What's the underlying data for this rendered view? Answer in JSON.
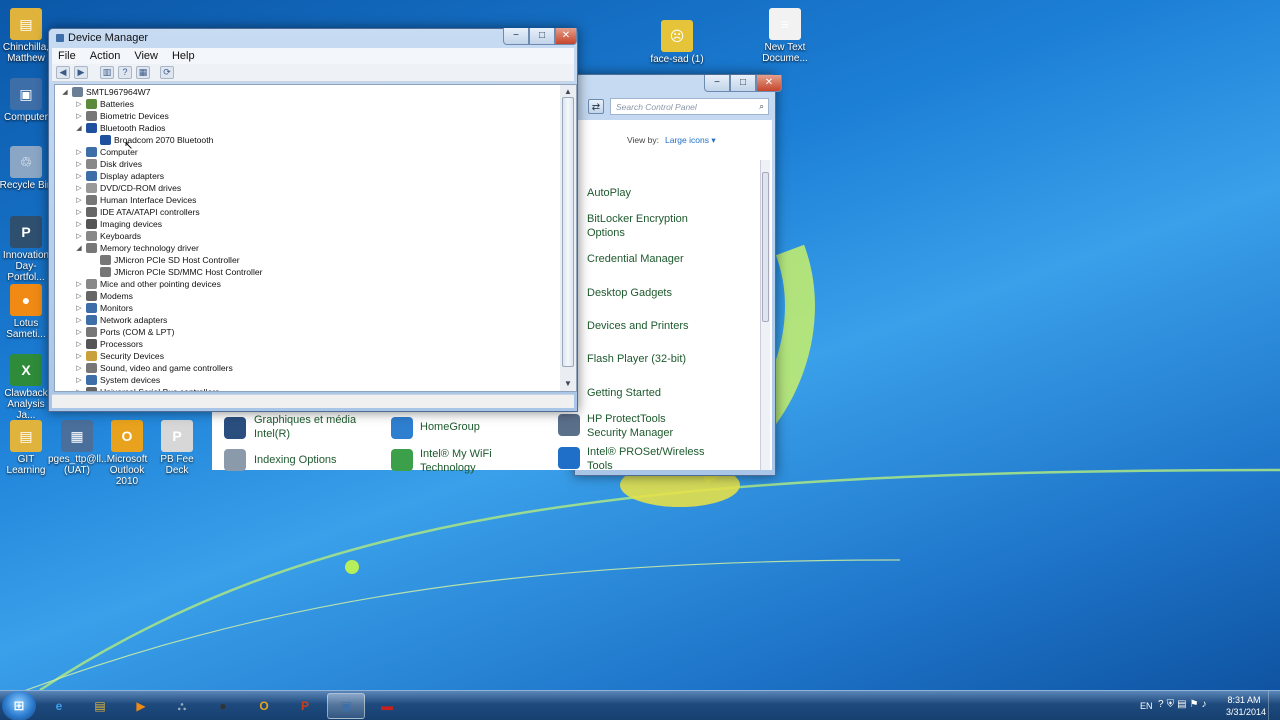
{
  "desktop": {
    "icons": [
      {
        "label": "Chinchilla, Matthew",
        "color": "#e0b43c",
        "glyph": "▤"
      },
      {
        "label": "Computer",
        "color": "#3d6ea8",
        "glyph": "▣"
      },
      {
        "label": "Recycle Bin",
        "color": "#8aa6c4",
        "glyph": "♲"
      },
      {
        "label": "Innovation Day-Portfol...",
        "color": "#2f4f6f",
        "glyph": "P"
      },
      {
        "label": "Lotus Sameti...",
        "color": "#f08a14",
        "glyph": "●"
      },
      {
        "label": "Clawback Analysis Ja...",
        "color": "#2e8b3a",
        "glyph": "X"
      },
      {
        "label": "GIT Learning",
        "color": "#e0b43c",
        "glyph": "▤"
      },
      {
        "label": "pges_ttp@ll... (UAT)",
        "color": "#4a6f9a",
        "glyph": "▦"
      },
      {
        "label": "Microsoft Outlook 2010",
        "color": "#e8a21d",
        "glyph": "O"
      },
      {
        "label": "PB Fee Deck",
        "color": "#d7d7d7",
        "glyph": "P"
      },
      {
        "label": "face-sad (1)",
        "color": "#e6c43a",
        "glyph": "☹"
      },
      {
        "label": "New Text Docume...",
        "color": "#f2f2f2",
        "glyph": "≡"
      }
    ]
  },
  "device_manager": {
    "title": "Device Manager",
    "menu": [
      "File",
      "Action",
      "View",
      "Help"
    ],
    "tree": [
      {
        "label": "SMTL967964W7",
        "level": 0,
        "expander": "◢",
        "color": "#6a7f96"
      },
      {
        "label": "Batteries",
        "level": 1,
        "expander": "▷",
        "color": "#5a8a3a"
      },
      {
        "label": "Biometric Devices",
        "level": 1,
        "expander": "▷",
        "color": "#777"
      },
      {
        "label": "Bluetooth Radios",
        "level": 1,
        "expander": "◢",
        "color": "#1f4f9f"
      },
      {
        "label": "Broadcom 2070 Bluetooth",
        "level": 2,
        "expander": "",
        "color": "#1f4f9f"
      },
      {
        "label": "Computer",
        "level": 1,
        "expander": "▷",
        "color": "#3d6ea8"
      },
      {
        "label": "Disk drives",
        "level": 1,
        "expander": "▷",
        "color": "#888"
      },
      {
        "label": "Display adapters",
        "level": 1,
        "expander": "▷",
        "color": "#3d6ea8"
      },
      {
        "label": "DVD/CD-ROM drives",
        "level": 1,
        "expander": "▷",
        "color": "#999"
      },
      {
        "label": "Human Interface Devices",
        "level": 1,
        "expander": "▷",
        "color": "#777"
      },
      {
        "label": "IDE ATA/ATAPI controllers",
        "level": 1,
        "expander": "▷",
        "color": "#666"
      },
      {
        "label": "Imaging devices",
        "level": 1,
        "expander": "▷",
        "color": "#555"
      },
      {
        "label": "Keyboards",
        "level": 1,
        "expander": "▷",
        "color": "#888"
      },
      {
        "label": "Memory technology driver",
        "level": 1,
        "expander": "◢",
        "color": "#777"
      },
      {
        "label": "JMicron PCIe SD Host Controller",
        "level": 2,
        "expander": "",
        "color": "#777"
      },
      {
        "label": "JMicron PCIe SD/MMC Host Controller",
        "level": 2,
        "expander": "",
        "color": "#777"
      },
      {
        "label": "Mice and other pointing devices",
        "level": 1,
        "expander": "▷",
        "color": "#888"
      },
      {
        "label": "Modems",
        "level": 1,
        "expander": "▷",
        "color": "#666"
      },
      {
        "label": "Monitors",
        "level": 1,
        "expander": "▷",
        "color": "#3d6ea8"
      },
      {
        "label": "Network adapters",
        "level": 1,
        "expander": "▷",
        "color": "#3d6ea8"
      },
      {
        "label": "Ports (COM & LPT)",
        "level": 1,
        "expander": "▷",
        "color": "#777"
      },
      {
        "label": "Processors",
        "level": 1,
        "expander": "▷",
        "color": "#555"
      },
      {
        "label": "Security Devices",
        "level": 1,
        "expander": "▷",
        "color": "#c9a13a"
      },
      {
        "label": "Sound, video and game controllers",
        "level": 1,
        "expander": "▷",
        "color": "#777"
      },
      {
        "label": "System devices",
        "level": 1,
        "expander": "▷",
        "color": "#3d6ea8"
      },
      {
        "label": "Universal Serial Bus controllers",
        "level": 1,
        "expander": "▷",
        "color": "#666"
      }
    ]
  },
  "control_panel": {
    "search_placeholder": "Search Control Panel",
    "view_by_label": "View by:",
    "view_by_value": "Large icons",
    "right_items": [
      {
        "label": "AutoPlay"
      },
      {
        "label": "BitLocker Encryption Options"
      },
      {
        "label": "Credential Manager"
      },
      {
        "label": "Desktop Gadgets"
      },
      {
        "label": "Devices and Printers"
      },
      {
        "label": "Flash Player (32-bit)"
      },
      {
        "label": "Getting Started"
      },
      {
        "label": "HP ProtectTools Security Manager",
        "color": "#5a6f8a"
      },
      {
        "label": "Intel® PROSet/Wireless Tools",
        "color": "#1f6fc8"
      }
    ],
    "bottom_items": [
      {
        "label": "Graphiques et média Intel(R)",
        "color": "#2a4f7f"
      },
      {
        "label": "HomeGroup",
        "color": "#2f7fd0"
      },
      {
        "label": "Indexing Options",
        "color": "#8a9aaa"
      },
      {
        "label": "Intel® My WiFi Technology",
        "color": "#3ca04a"
      }
    ]
  },
  "taskbar": {
    "buttons": [
      {
        "name": "internet-explorer",
        "glyph": "e",
        "color": "#3aa0ea",
        "active": false
      },
      {
        "name": "windows-explorer",
        "glyph": "▤",
        "color": "#e0b43c",
        "active": false
      },
      {
        "name": "media-player",
        "glyph": "▶",
        "color": "#f08a14",
        "active": false
      },
      {
        "name": "network",
        "glyph": "⛬",
        "color": "#9ab",
        "active": false
      },
      {
        "name": "lotus",
        "glyph": "●",
        "color": "#333",
        "active": false
      },
      {
        "name": "outlook",
        "glyph": "O",
        "color": "#e8a21d",
        "active": false
      },
      {
        "name": "powerpoint",
        "glyph": "P",
        "color": "#c8401e",
        "active": false
      },
      {
        "name": "device-manager",
        "glyph": "▣",
        "color": "#3d6ea8",
        "active": true
      },
      {
        "name": "toolbox",
        "glyph": "▬",
        "color": "#c8201e",
        "active": false
      }
    ],
    "language": "EN",
    "time": "8:31 AM",
    "date": "3/31/2014"
  }
}
